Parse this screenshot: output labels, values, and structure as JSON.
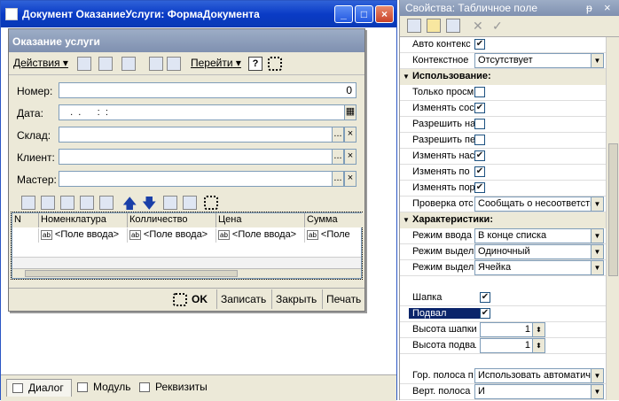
{
  "main_window": {
    "title": "Документ ОказаниеУслуги: ФормаДокумента",
    "minimize": "_",
    "maximize": "□",
    "close": "×"
  },
  "bottom_tabs": [
    "Диалог",
    "Модуль",
    "Реквизиты"
  ],
  "form": {
    "title": "Оказание услуги",
    "toolbar": {
      "actions": "Действия",
      "goto": "Перейти",
      "help": "?"
    },
    "fields": [
      {
        "label": "Номер:",
        "value": "0"
      },
      {
        "label": "Дата:",
        "value": "  .  .      :  :"
      },
      {
        "label": "Склад:",
        "value": ""
      },
      {
        "label": "Клиент:",
        "value": ""
      },
      {
        "label": "Мастер:",
        "value": ""
      }
    ],
    "field_buttons": {
      "select": "...",
      "clear": "×"
    },
    "table": {
      "columns": [
        "N",
        "Номенклатура",
        "Колличество",
        "Цена",
        "Сумма"
      ],
      "cell_text": "<Поле ввода>",
      "cell_badge": "ab",
      "last_cell": "<Поле"
    },
    "bottom_buttons": [
      "OK",
      "Записать",
      "Закрыть",
      "Печать"
    ]
  },
  "properties": {
    "title": "Свойства: Табличное поле",
    "pin": "ᵽ",
    "close": "×",
    "rows_top": [
      {
        "name": "Авто контекс",
        "type": "check",
        "checked": true,
        "mark": "✔"
      },
      {
        "name": "Контекстное",
        "type": "select",
        "value": "Отсутствует"
      }
    ],
    "section_usage": "Использование:",
    "rows_usage": [
      {
        "name": "Только просм",
        "type": "check",
        "checked": false,
        "mark": ""
      },
      {
        "name": "Изменять сос",
        "type": "check",
        "checked": true,
        "mark": "✔"
      },
      {
        "name": "Разрешить на",
        "type": "check",
        "checked": false,
        "mark": ""
      },
      {
        "name": "Разрешить пе",
        "type": "check",
        "checked": false,
        "mark": ""
      },
      {
        "name": "Изменять нас",
        "type": "check",
        "checked": true,
        "mark": "✔"
      },
      {
        "name": "Изменять по",
        "type": "check",
        "checked": true,
        "mark": "✔"
      },
      {
        "name": "Изменять пор",
        "type": "check",
        "checked": true,
        "mark": "✔"
      },
      {
        "name": "Проверка отс",
        "type": "select",
        "value": "Сообщать о несоответствии"
      }
    ],
    "section_chars": "Характеристики:",
    "rows_chars": [
      {
        "name": "Режим ввода",
        "type": "select",
        "value": "В конце списка"
      },
      {
        "name": "Режим выдел",
        "type": "select",
        "value": "Одиночный"
      },
      {
        "name": "Режим выдел",
        "type": "select",
        "value": "Ячейка"
      }
    ],
    "rows_header": [
      {
        "name": "Шапка",
        "type": "check",
        "checked": true,
        "mark": "✔"
      },
      {
        "name": "Подвал",
        "type": "check",
        "checked": true,
        "mark": "✔"
      },
      {
        "name": "Высота шапки",
        "type": "spin",
        "value": "1"
      },
      {
        "name": "Высота подвала",
        "type": "spin",
        "value": "1"
      }
    ],
    "rows_bottom": [
      {
        "name": "Гор. полоса п",
        "type": "select",
        "value": "Использовать автоматически"
      },
      {
        "name": "Верт. полоса",
        "type": "select",
        "value": "И"
      }
    ]
  }
}
